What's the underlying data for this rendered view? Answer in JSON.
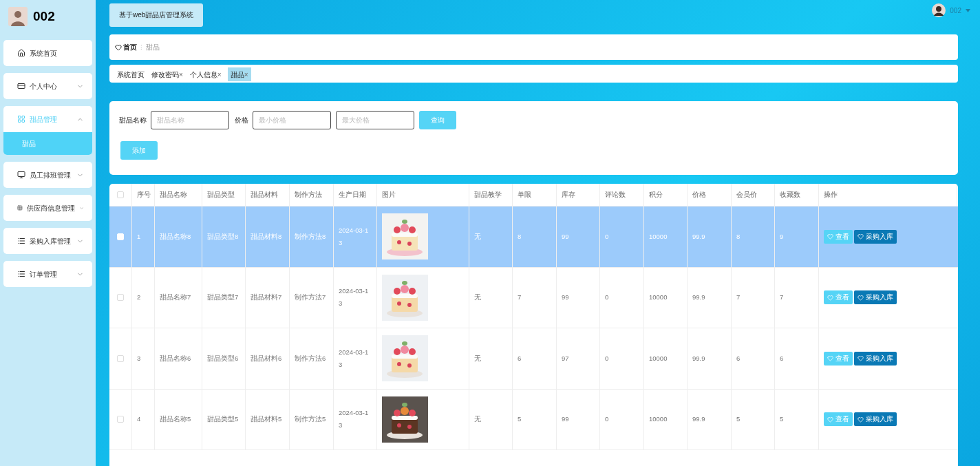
{
  "sidebar": {
    "username": "002",
    "items": [
      {
        "label": "系统首页"
      },
      {
        "label": "个人中心",
        "expanded": false
      },
      {
        "label": "甜品管理",
        "expanded": true,
        "children": [
          {
            "label": "甜品",
            "selected": true
          }
        ]
      },
      {
        "label": "员工排班管理",
        "expanded": false
      },
      {
        "label": "供应商信息管理",
        "expanded": false
      },
      {
        "label": "采购入库管理",
        "expanded": false
      },
      {
        "label": "订单管理",
        "expanded": false
      }
    ]
  },
  "header": {
    "title": "基于web甜品店管理系统",
    "user": "002"
  },
  "breadcrumb": {
    "home": "首页",
    "separator": "⁝",
    "current": "甜品"
  },
  "tabs": [
    {
      "label": "系统首页",
      "selected": false
    },
    {
      "label": "修改密码",
      "close": "×",
      "selected": false
    },
    {
      "label": "个人信息",
      "close": "×",
      "selected": false
    },
    {
      "label": "甜品",
      "close": "×",
      "selected": true
    }
  ],
  "search": {
    "name_label": "甜品名称",
    "name_placeholder": "甜品名称",
    "price_label": "价格",
    "min_placeholder": "最小价格",
    "max_placeholder": "最大价格",
    "query_button": "查询",
    "add_button": "添加"
  },
  "table": {
    "all_checked": false,
    "columns": [
      "序号",
      "甜品名称",
      "甜品类型",
      "甜品材料",
      "制作方法",
      "生产日期",
      "图片",
      "甜品教学",
      "单限",
      "库存",
      "评论数",
      "积分",
      "价格",
      "会员价",
      "收藏数",
      "操作"
    ],
    "rows": [
      {
        "selected": true,
        "checked": false,
        "cells": [
          "1",
          "甜品名称8",
          "甜品类型8",
          "甜品材料8",
          "制作方法8",
          "2024-03-13",
          {
            "kind": "picture"
          },
          "无",
          "8",
          "99",
          "0",
          "10000",
          "99.9",
          "8",
          "9"
        ],
        "actions": [
          "查看",
          "采购入库"
        ]
      },
      {
        "selected": false,
        "checked": false,
        "cells": [
          "2",
          "甜品名称7",
          "甜品类型7",
          "甜品材料7",
          "制作方法7",
          "2024-03-13",
          {
            "kind": "picture"
          },
          "无",
          "7",
          "99",
          "0",
          "10000",
          "99.9",
          "7",
          "7"
        ],
        "actions": [
          "查看",
          "采购入库"
        ]
      },
      {
        "selected": false,
        "checked": false,
        "cells": [
          "3",
          "甜品名称6",
          "甜品类型6",
          "甜品材料6",
          "制作方法6",
          "2024-03-13",
          {
            "kind": "picture"
          },
          "无",
          "6",
          "97",
          "0",
          "10000",
          "99.9",
          "6",
          "6"
        ],
        "actions": [
          "查看",
          "采购入库"
        ]
      },
      {
        "selected": false,
        "checked": false,
        "cells": [
          "4",
          "甜品名称5",
          "甜品类型5",
          "甜品材料5",
          "制作方法5",
          "2024-03-13",
          {
            "kind": "picture"
          },
          "无",
          "5",
          "99",
          "0",
          "10000",
          "99.9",
          "5",
          "5"
        ],
        "actions": [
          "查看",
          "采购入库"
        ]
      }
    ]
  }
}
